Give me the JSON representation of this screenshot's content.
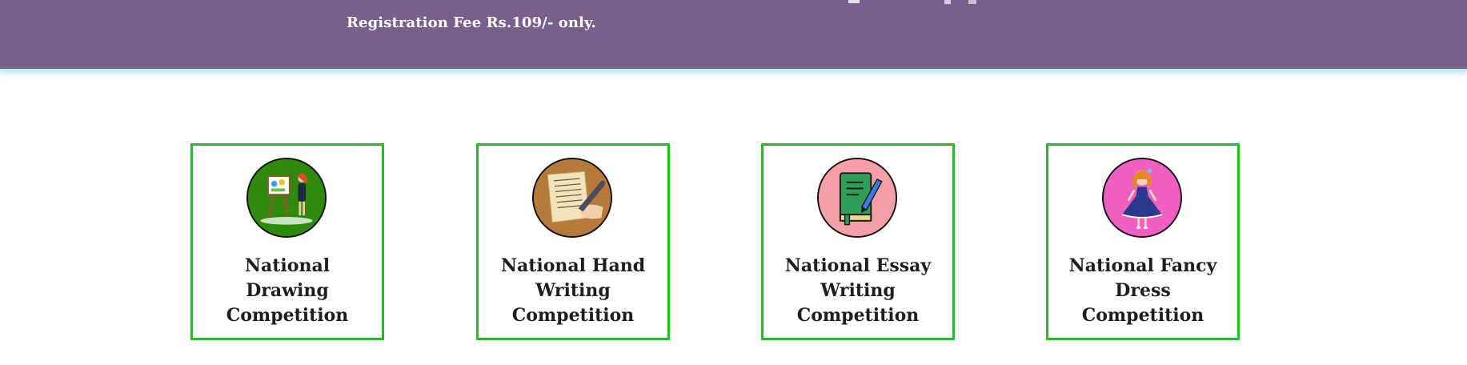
{
  "banner": {
    "fee_text": "Registration Fee Rs.109/- only.",
    "background": "#776089"
  },
  "competitions": [
    {
      "label": "National Drawing Competition",
      "icon": "painter-easel-icon",
      "icon_bg": "#2e8a0d"
    },
    {
      "label": "National Hand Writing Competition",
      "icon": "handwriting-quill-icon",
      "icon_bg": "#b57a3a"
    },
    {
      "label": "National Essay Writing Competition",
      "icon": "essay-book-pen-icon",
      "icon_bg": "#f5a0a8"
    },
    {
      "label": "National Fancy Dress Competition",
      "icon": "fancy-dress-girl-icon",
      "icon_bg": "#f25fc3"
    }
  ],
  "colors": {
    "card_border": "#1fbf1f",
    "label_text": "#1e1e1e"
  }
}
